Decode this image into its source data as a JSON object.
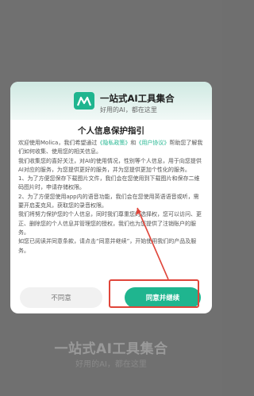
{
  "background": {
    "title": "一站式AI工具集合",
    "subtitle": "好用的AI，都在这里"
  },
  "dialog": {
    "app_title": "一站式AI工具集合",
    "app_subtitle": "好用的AI，都在这里",
    "modal_title": "个人信息保护指引",
    "body": {
      "p1_a": "欢迎使用Molica，我们希望通过",
      "p1_link1": "《隐私政策》",
      "p1_b": "和",
      "p1_link2": "《用户协议》",
      "p1_c": "帮助您了解我们如何收集、使用您的相关信息。",
      "p2": "我们收集您的喜好关注，对AI的使用情况，性别等个人信息，用于向您提供AI对应的服务，为您提供更好的服务，并为您提供更加个性化的服务。",
      "p3": "1、为了方便您保存下载图片文件，我们会在您使用到下载图片和保存二维码图片时，申请存储权限。",
      "p4": "2、为了方便您使用app内的语音功能，我们会在您使用英语语音或听，需要开启麦克风，获取您的录音权限。",
      "p5": "我们将努力保护您的个人信息，同时我们尊重您的选择权，您可以访问、更正、删除您的个人信息并管理您的授权，我们也为您提供了注销账户的服务。",
      "p6": "如您已阅读并同意条款，请点击“同意并继续”，开始使用我们的产品及服务。"
    },
    "buttons": {
      "disagree": "不同意",
      "agree": "同意并继续"
    }
  },
  "colors": {
    "accent": "#1fb58f",
    "annotation": "#e0453a"
  }
}
